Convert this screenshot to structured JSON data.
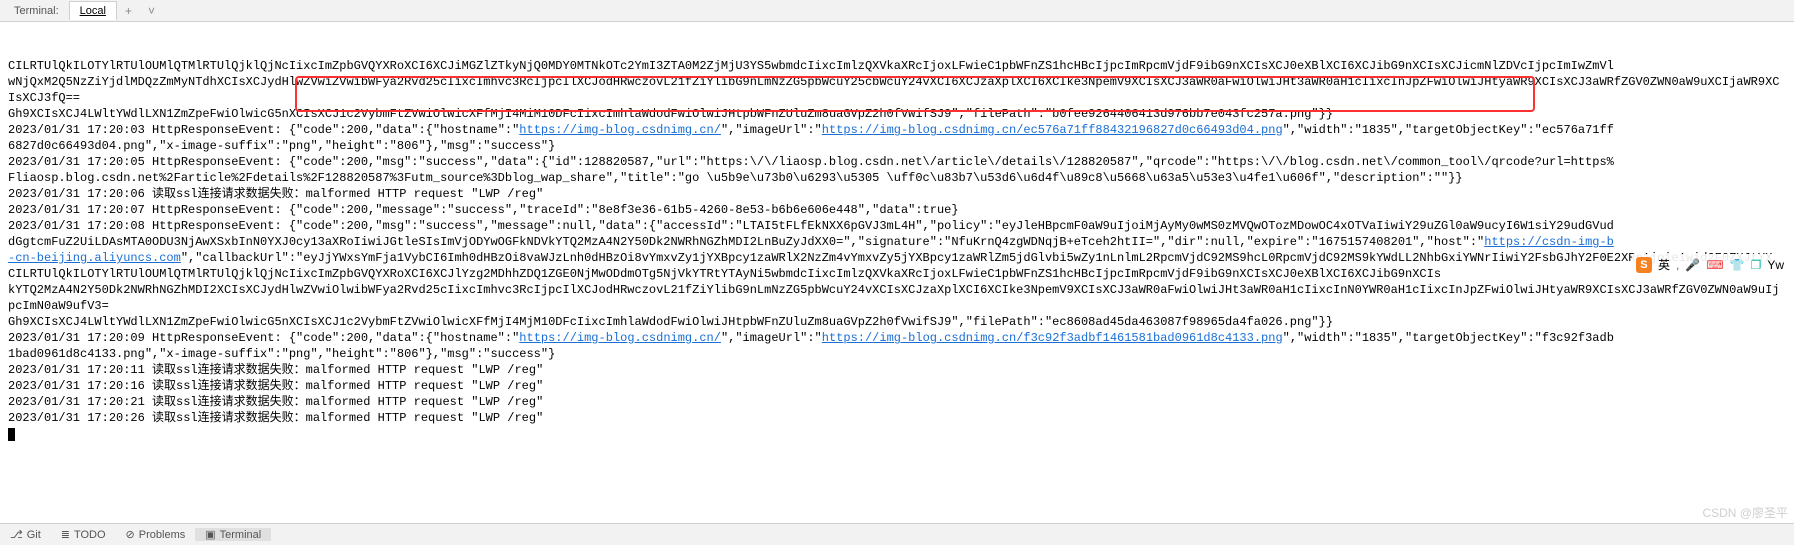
{
  "tabs": {
    "label": "Terminal:",
    "active": "Local",
    "add": "+",
    "more": "˅"
  },
  "log": {
    "lines": [
      {
        "segs": [
          {
            "t": "CILRTUlQkILOTYlRTUlOUMlQTMlRTUlQjklQjNcIixcImZpbGVQYXRoXCI6XCJiMGZlZTkyNjQ0MDY0MTNkOTc2YmI3ZTA0M2ZjMjU3YS5wbmdcIixcImlzQXVkaXRcIjoxLFwieC1pbWFnZS1hcHBcIjpcImRpcmVjdF9ibG9nXCIsXCJ0eXBlXCI6XCJibG9nXCIsXCJicmNlZDVcIjpcImIwZmVl"
          }
        ]
      },
      {
        "segs": [
          {
            "t": "wNjQxM2Q5NzZiYjdlMDQzZmMyNTdhXCIsXCJydHlwZVwiZVwibWFya2Rvd25cIixcImhvc3RcIjpcIlXCJodHRwczovL21fZiYlibG9nLmNzZG5pbWcuY25cbWcuY24vXCI6XCJzaXplXCI6XCIke3NpemV9XCIsXCJ3aWR0aFwiOlwiJHt3aWR0aH1cIixcInJpZFwiOlwiJHtyaWR9XCIsXCJ3aWRfZGV0ZWN0aW9uXCIjaWR9XCIsXCJ3fQ=="
          }
        ]
      },
      {
        "segs": [
          {
            "t": "Gh9XCIsXCJ4LWltYWdlLXN1ZmZpeFwiOlwicG"
          },
          {
            "t": "5nXCIsXCJ1c2VybmFtZVwiOlwicXFfMjI4MiM10DFcIixcImhlaWdodFwiOlwiJHtpbWFnZUluZm8uaGVpZ2h0fVwifSJ9\",\"filePath\":\"b0fee9264406413d976bb7e043fc257a.png\"}}",
            "u": true
          }
        ]
      },
      {
        "segs": [
          {
            "t": "2023/01/31 17:20:03 HttpResponseEvent"
          },
          {
            "t": ": {\"code\":200,\"data\":{\"hostname\":\""
          },
          {
            "t": "https://img-blog.csdnimg.cn/",
            "link": true
          },
          {
            "t": "\",\"imageUrl\":\""
          },
          {
            "t": "https://img-blog.csdnimg.cn/ec576a71ff88432196827d0c66493d04.png",
            "link": true
          },
          {
            "t": "\",\"width\":\"1835\",\"targetObjectKey\":\"ec576a71ff"
          }
        ]
      },
      {
        "segs": [
          {
            "t": "6827d0c66493d04.png\",\"x-image-suffix"
          },
          {
            "t": "\":\"png\",\"height\":\"806\"},\"msg\":\"success\"}"
          }
        ]
      },
      {
        "segs": [
          {
            "t": "2023/01/31 17:20:05 HttpResponseEvent: {\"code\":200,\"msg\":\"success\",\"data\":{\"id\":128820587,\"url\":\"https:\\/\\/liaosp.blog.csdn.net\\/article\\/details\\/128820587\",\"qrcode\":\"https:\\/\\/blog.csdn.net\\/common_tool\\/qrcode?url=https%"
          }
        ]
      },
      {
        "segs": [
          {
            "t": "Fliaosp.blog.csdn.net%2Farticle%2Fdetails%2F128820587%3Futm_source%3Dblog_wap_share\",\"title\":\"go \\u5b9e\\u73b0\\u6293\\u5305 \\uff0c\\u83b7\\u53d6\\u6d4f\\u89c8\\u5668\\u63a5\\u53e3\\u4fe1\\u606f\",\"description\":\"\"}}"
          }
        ]
      },
      {
        "segs": [
          {
            "t": "2023/01/31 17:20:06 读取ssl连接请求数据失败：malformed HTTP request \"LWP /reg\""
          }
        ]
      },
      {
        "segs": [
          {
            "t": "2023/01/31 17:20:07 HttpResponseEvent: {\"code\":200,\"message\":\"success\",\"traceId\":\"8e8f3e36-61b5-4260-8e53-b6b6e606e448\",\"data\":true}"
          }
        ]
      },
      {
        "segs": [
          {
            "t": "2023/01/31 17:20:08 HttpResponseEvent: {\"code\":200,\"msg\":\"success\",\"message\":null,\"data\":{\"accessId\":\"LTAI5tFLfEkNXX6pGVJ3mL4H\",\"policy\":\"eyJleHBpcmF0aW9uIjoiMjAyMy0wMS0zMVQwOTozMDowOC4xOTVaIiwiY29uZGl0aW9ucyI6W1siY29udGVud"
          }
        ]
      },
      {
        "segs": [
          {
            "t": "dGgtcmFuZ2UiLDAsMTA0ODU3NjAwXSxbInN0YXJ0cy13aXRoIiwiJGtleSIsImVjODYwOGFkNDVkYTQ2MzA4N2Y50Dk2NWRhNGZhMDI2LnBuZyJdXX0=\",\"signature\":\"NfuKrnQ4zgWDNqjB+eTceh2htII=\",\"dir\":null,\"expire\":\"1675157408201\",\"host\":\""
          },
          {
            "t": "https://csdn-img-b",
            "link": true
          }
        ]
      },
      {
        "segs": [
          {
            "t": "-cn-beijing.aliyuncs.com",
            "link": true
          },
          {
            "t": "\",\"callbackUrl\":\"eyJjYWxsYmFja1VybCI6Imh0dHBzOi8vaWJzLnh0dHBzOi8vYmxvZy1jYXBpcy1zaWRlX2NzZm4vYmxvZy5jYXBpcy1zaWRlZm5jdGlvbi5wZy1nLnlmL2RpcmVjdC92MS9hcL0RpcmVjdC92MS9kYWdLL2NhbGxiYWNrIiwiY2FsbGJhY2F0E2XRp1joie1wid2F0ZXJtYX"
          }
        ]
      },
      {
        "segs": [
          {
            "t": "CILRTUlQkILOTYlRTUlOUMlQTMlRTUlQjklQjNcIixcImZpbGVQYXRoXCI6XCJlYzg2MDhhZDQ1ZGE0NjMwODdmOTg5NjVkYTRtYTAyNi5wbmdcIixcImlzQXVkaXRcIjoxLFwieC1pbWFnZS1hcHBcIjpcImRpcmVjdF9ibG9nXCIsXCJ0eXBlXCI6XCJibG9nXCIs"
          }
        ]
      },
      {
        "segs": [
          {
            "t": "kYTQ2MzA4N2Y50Dk2NWRhNGZhMDI2XCIsXCJydHlwZVwiOlwibWFya2Rvd25cIixcImhvc3RcIjpcIlXCJodHRwczovL21fZiYlibG9nLmNzZG5pbWcuY24vXCIsXCJzaXplXCI6XCIke3NpemV9XCIsXCJ3aWR0aFwiOlwiJHt3aWR0aH1cIixcInN0YWR0aH1cIixcInJpZFwiOlwiJHtyaWR9XCIsXCJ3aWRfZGV0ZWN0aW9uIjpcImN0aW9ufV3="
          }
        ]
      },
      {
        "segs": [
          {
            "t": "Gh9XCIsXCJ4LWltYWdlLXN1ZmZpeFwiOlwicG5nXCIsXCJ1c2VybmFtZVwiOlwicXFfMjI4MjM10DFcIixcImhlaWdodFwiOlwiJHtpbWFnZUluZm8uaGVpZ2h0fVwifSJ9\",\"filePath\":\"ec8608ad45da463087f98965da4fa026.png\"}}"
          }
        ]
      },
      {
        "segs": [
          {
            "t": "2023/01/31 17:20:09 HttpResponseEvent: {\"code\":200,\"data\":{\"hostname\":\""
          },
          {
            "t": "https://img-blog.csdnimg.cn/",
            "link": true
          },
          {
            "t": "\",\"imageUrl\":\""
          },
          {
            "t": "https://img-blog.csdnimg.cn/f3c92f3adbf1461581bad0961d8c4133.png",
            "link": true
          },
          {
            "t": "\",\"width\":\"1835\",\"targetObjectKey\":\"f3c92f3adb"
          }
        ]
      },
      {
        "segs": [
          {
            "t": "1bad0961d8c4133.png\",\"x-image-suffix\":\"png\",\"height\":\"806\"},\"msg\":\"success\"}"
          }
        ]
      },
      {
        "segs": [
          {
            "t": "2023/01/31 17:20:11 读取ssl连接请求数据失败：malformed HTTP request \"LWP /reg\""
          }
        ]
      },
      {
        "segs": [
          {
            "t": "2023/01/31 17:20:16 读取ssl连接请求数据失败：malformed HTTP request \"LWP /reg\""
          }
        ]
      },
      {
        "segs": [
          {
            "t": "2023/01/31 17:20:21 读取ssl连接请求数据失败：malformed HTTP request \"LWP /reg\""
          }
        ]
      },
      {
        "segs": [
          {
            "t": "2023/01/31 17:20:26 读取ssl连接请求数据失败：malformed HTTP request \"LWP /reg\""
          }
        ]
      }
    ]
  },
  "bottom": {
    "git": "Git",
    "todo": "TODO",
    "problems": "Problems",
    "terminal": "Terminal"
  },
  "watermark": "CSDN @廖圣平",
  "float": {
    "lang": "英",
    "yw": "Yw"
  }
}
